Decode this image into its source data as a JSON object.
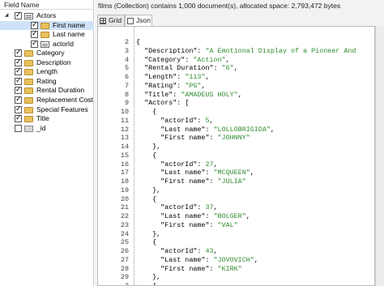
{
  "field_panel": {
    "header": "Field Name",
    "items": [
      {
        "label": "Actors",
        "icon": "actors-doc-icon",
        "checked": true,
        "expanded": true,
        "level": 0
      },
      {
        "label": "First name",
        "icon": "folder-icon",
        "checked": true,
        "level": 1
      },
      {
        "label": "Last name",
        "icon": "folder-icon",
        "checked": true,
        "level": 1
      },
      {
        "label": "actorId",
        "icon": "number-field-icon",
        "checked": true,
        "level": 1
      },
      {
        "label": "Category",
        "icon": "folder-icon",
        "checked": true,
        "level": 0
      },
      {
        "label": "Description",
        "icon": "folder-icon",
        "checked": true,
        "level": 0
      },
      {
        "label": "Length",
        "icon": "folder-icon",
        "checked": true,
        "level": 0
      },
      {
        "label": "Rating",
        "icon": "folder-icon",
        "checked": true,
        "level": 0
      },
      {
        "label": "Rental Duration",
        "icon": "folder-icon",
        "checked": true,
        "level": 0
      },
      {
        "label": "Replacement Cost",
        "icon": "folder-icon",
        "checked": true,
        "level": 0
      },
      {
        "label": "Special Features",
        "icon": "folder-icon",
        "checked": true,
        "level": 0
      },
      {
        "label": "Title",
        "icon": "folder-icon",
        "checked": true,
        "level": 0
      },
      {
        "label": "_id",
        "icon": "id-field-icon",
        "checked": false,
        "level": 0
      }
    ]
  },
  "status_text": "films (Collection) contains 1,000 document(s), allocated space: 2,793,472 bytes",
  "tabs": [
    {
      "label": "Grid",
      "active": false
    },
    {
      "label": "Json",
      "active": true
    }
  ],
  "json_lines": [
    {
      "n": "2",
      "t": "{"
    },
    {
      "n": "3",
      "t": "  \"Description\": \"A Emotional Display of a Pioneer And"
    },
    {
      "n": "4",
      "t": "  \"Category\": \"Action\","
    },
    {
      "n": "5",
      "t": "  \"Rental Duration\": \"6\","
    },
    {
      "n": "6",
      "t": "  \"Length\": \"113\","
    },
    {
      "n": "7",
      "t": "  \"Rating\": \"PG\","
    },
    {
      "n": "8",
      "t": "  \"Title\": \"AMADEUS HOLY\","
    },
    {
      "n": "9",
      "t": "  \"Actors\": ["
    },
    {
      "n": "10",
      "t": "    {"
    },
    {
      "n": "11",
      "t": "      \"actorId\": 5,"
    },
    {
      "n": "12",
      "t": "      \"Last name\": \"LOLLOBRIGIDA\","
    },
    {
      "n": "13",
      "t": "      \"First name\": \"JOHNNY\""
    },
    {
      "n": "14",
      "t": "    },"
    },
    {
      "n": "15",
      "t": "    {"
    },
    {
      "n": "16",
      "t": "      \"actorId\": 27,"
    },
    {
      "n": "17",
      "t": "      \"Last name\": \"MCQUEEN\","
    },
    {
      "n": "18",
      "t": "      \"First name\": \"JULIA\""
    },
    {
      "n": "19",
      "t": "    },"
    },
    {
      "n": "20",
      "t": "    {"
    },
    {
      "n": "21",
      "t": "      \"actorId\": 37,"
    },
    {
      "n": "22",
      "t": "      \"Last name\": \"BOLGER\","
    },
    {
      "n": "23",
      "t": "      \"First name\": \"VAL\""
    },
    {
      "n": "24",
      "t": "    },"
    },
    {
      "n": "25",
      "t": "    {"
    },
    {
      "n": "26",
      "t": "      \"actorId\": 43,"
    },
    {
      "n": "27",
      "t": "      \"Last name\": \"JOVOVICH\","
    },
    {
      "n": "28",
      "t": "      \"First name\": \"KIRK\""
    },
    {
      "n": "29",
      "t": "    },"
    },
    {
      "n": "3",
      "t": "    {"
    }
  ],
  "colors": {
    "string": "#2e8b2e",
    "selection": "#cfe2f7"
  }
}
